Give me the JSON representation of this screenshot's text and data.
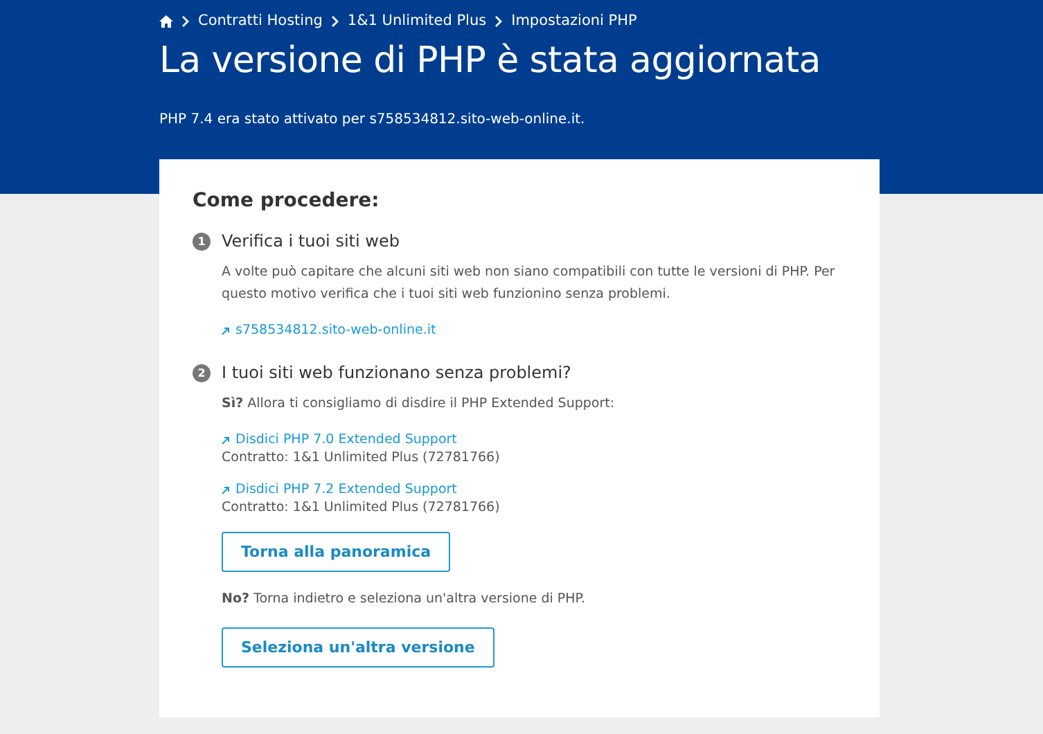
{
  "breadcrumb": [
    "Contratti Hosting",
    "1&1 Unlimited Plus",
    "Impostazioni PHP"
  ],
  "title": "La versione di PHP è stata aggiornata",
  "subtitle": "PHP 7.4 era stato attivato per s758534812.sito-web-online.it.",
  "card": {
    "heading": "Come procedere:",
    "steps": [
      {
        "number": "1",
        "title": "Verifica i tuoi siti web",
        "content": [
          {
            "kind": "paragraph",
            "text": "A volte può capitare che alcuni siti web non siano compatibili con tutte le versioni di PHP. Per questo motivo verifica che i tuoi siti web funzionino senza problemi."
          },
          {
            "kind": "link",
            "text": "s758534812.sito-web-online.it"
          }
        ]
      },
      {
        "number": "2",
        "title": "I tuoi siti web funzionano senza problemi?",
        "content": [
          {
            "kind": "paragraph",
            "text": "**Sì?** Allora ti consigliamo di disdire il PHP Extended Support:"
          },
          {
            "kind": "link",
            "text": "Disdici PHP 7.0 Extended Support",
            "detail": "Contratto: 1&1 Unlimited Plus (72781766)"
          },
          {
            "kind": "link",
            "text": "Disdici PHP 7.2 Extended Support",
            "detail": "Contratto: 1&1 Unlimited Plus (72781766)"
          },
          {
            "kind": "button",
            "text": "Torna alla panoramica"
          },
          {
            "kind": "paragraph",
            "text": "**No?** Torna indietro e seleziona un'altra versione di PHP."
          },
          {
            "kind": "button",
            "text": "Seleziona un'altra versione"
          }
        ]
      }
    ]
  }
}
